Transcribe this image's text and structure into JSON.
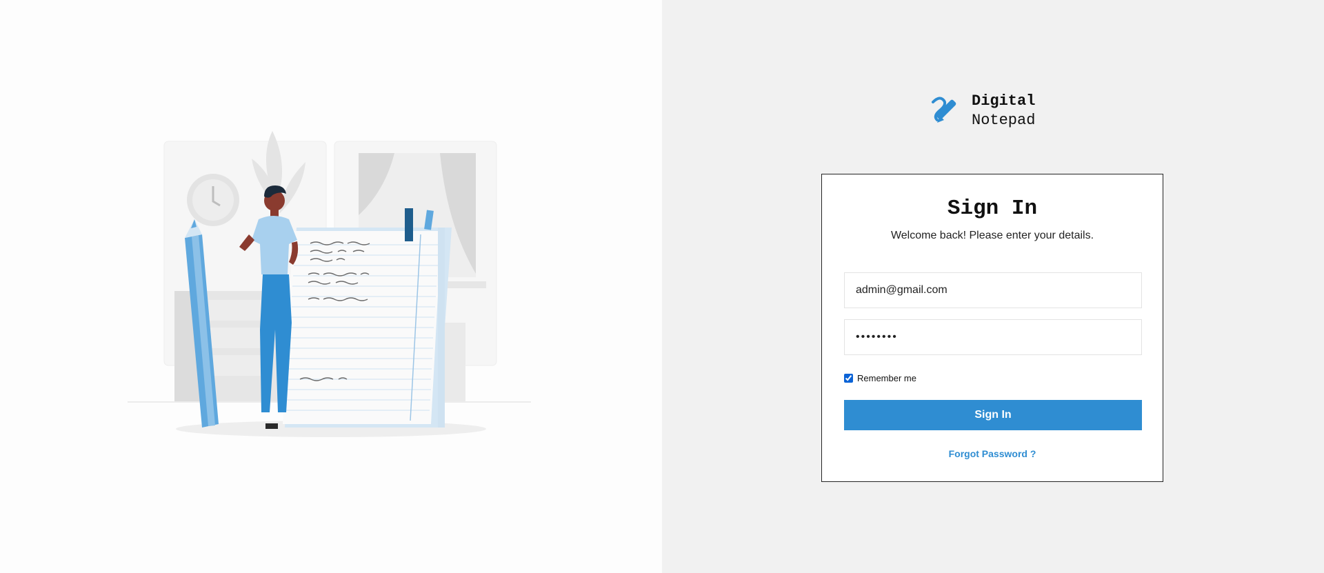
{
  "brand": {
    "name_line1": "Digital",
    "name_line2": "Notepad",
    "icon": "pencil-logo-icon",
    "color": "#2f8dd2"
  },
  "signin": {
    "title": "Sign In",
    "subtitle": "Welcome back! Please enter your details.",
    "email_value": "admin@gmail.com",
    "password_value": "••••••••",
    "remember_label": "Remember me",
    "remember_checked": true,
    "button_label": "Sign In",
    "forgot_label": "Forgot Password ?"
  },
  "illustration": {
    "icon": "person-with-pencil-and-notepad-illustration"
  },
  "colors": {
    "accent": "#2f8dd2",
    "left_bg": "#fdfdfd",
    "right_bg": "#f1f1f1"
  }
}
